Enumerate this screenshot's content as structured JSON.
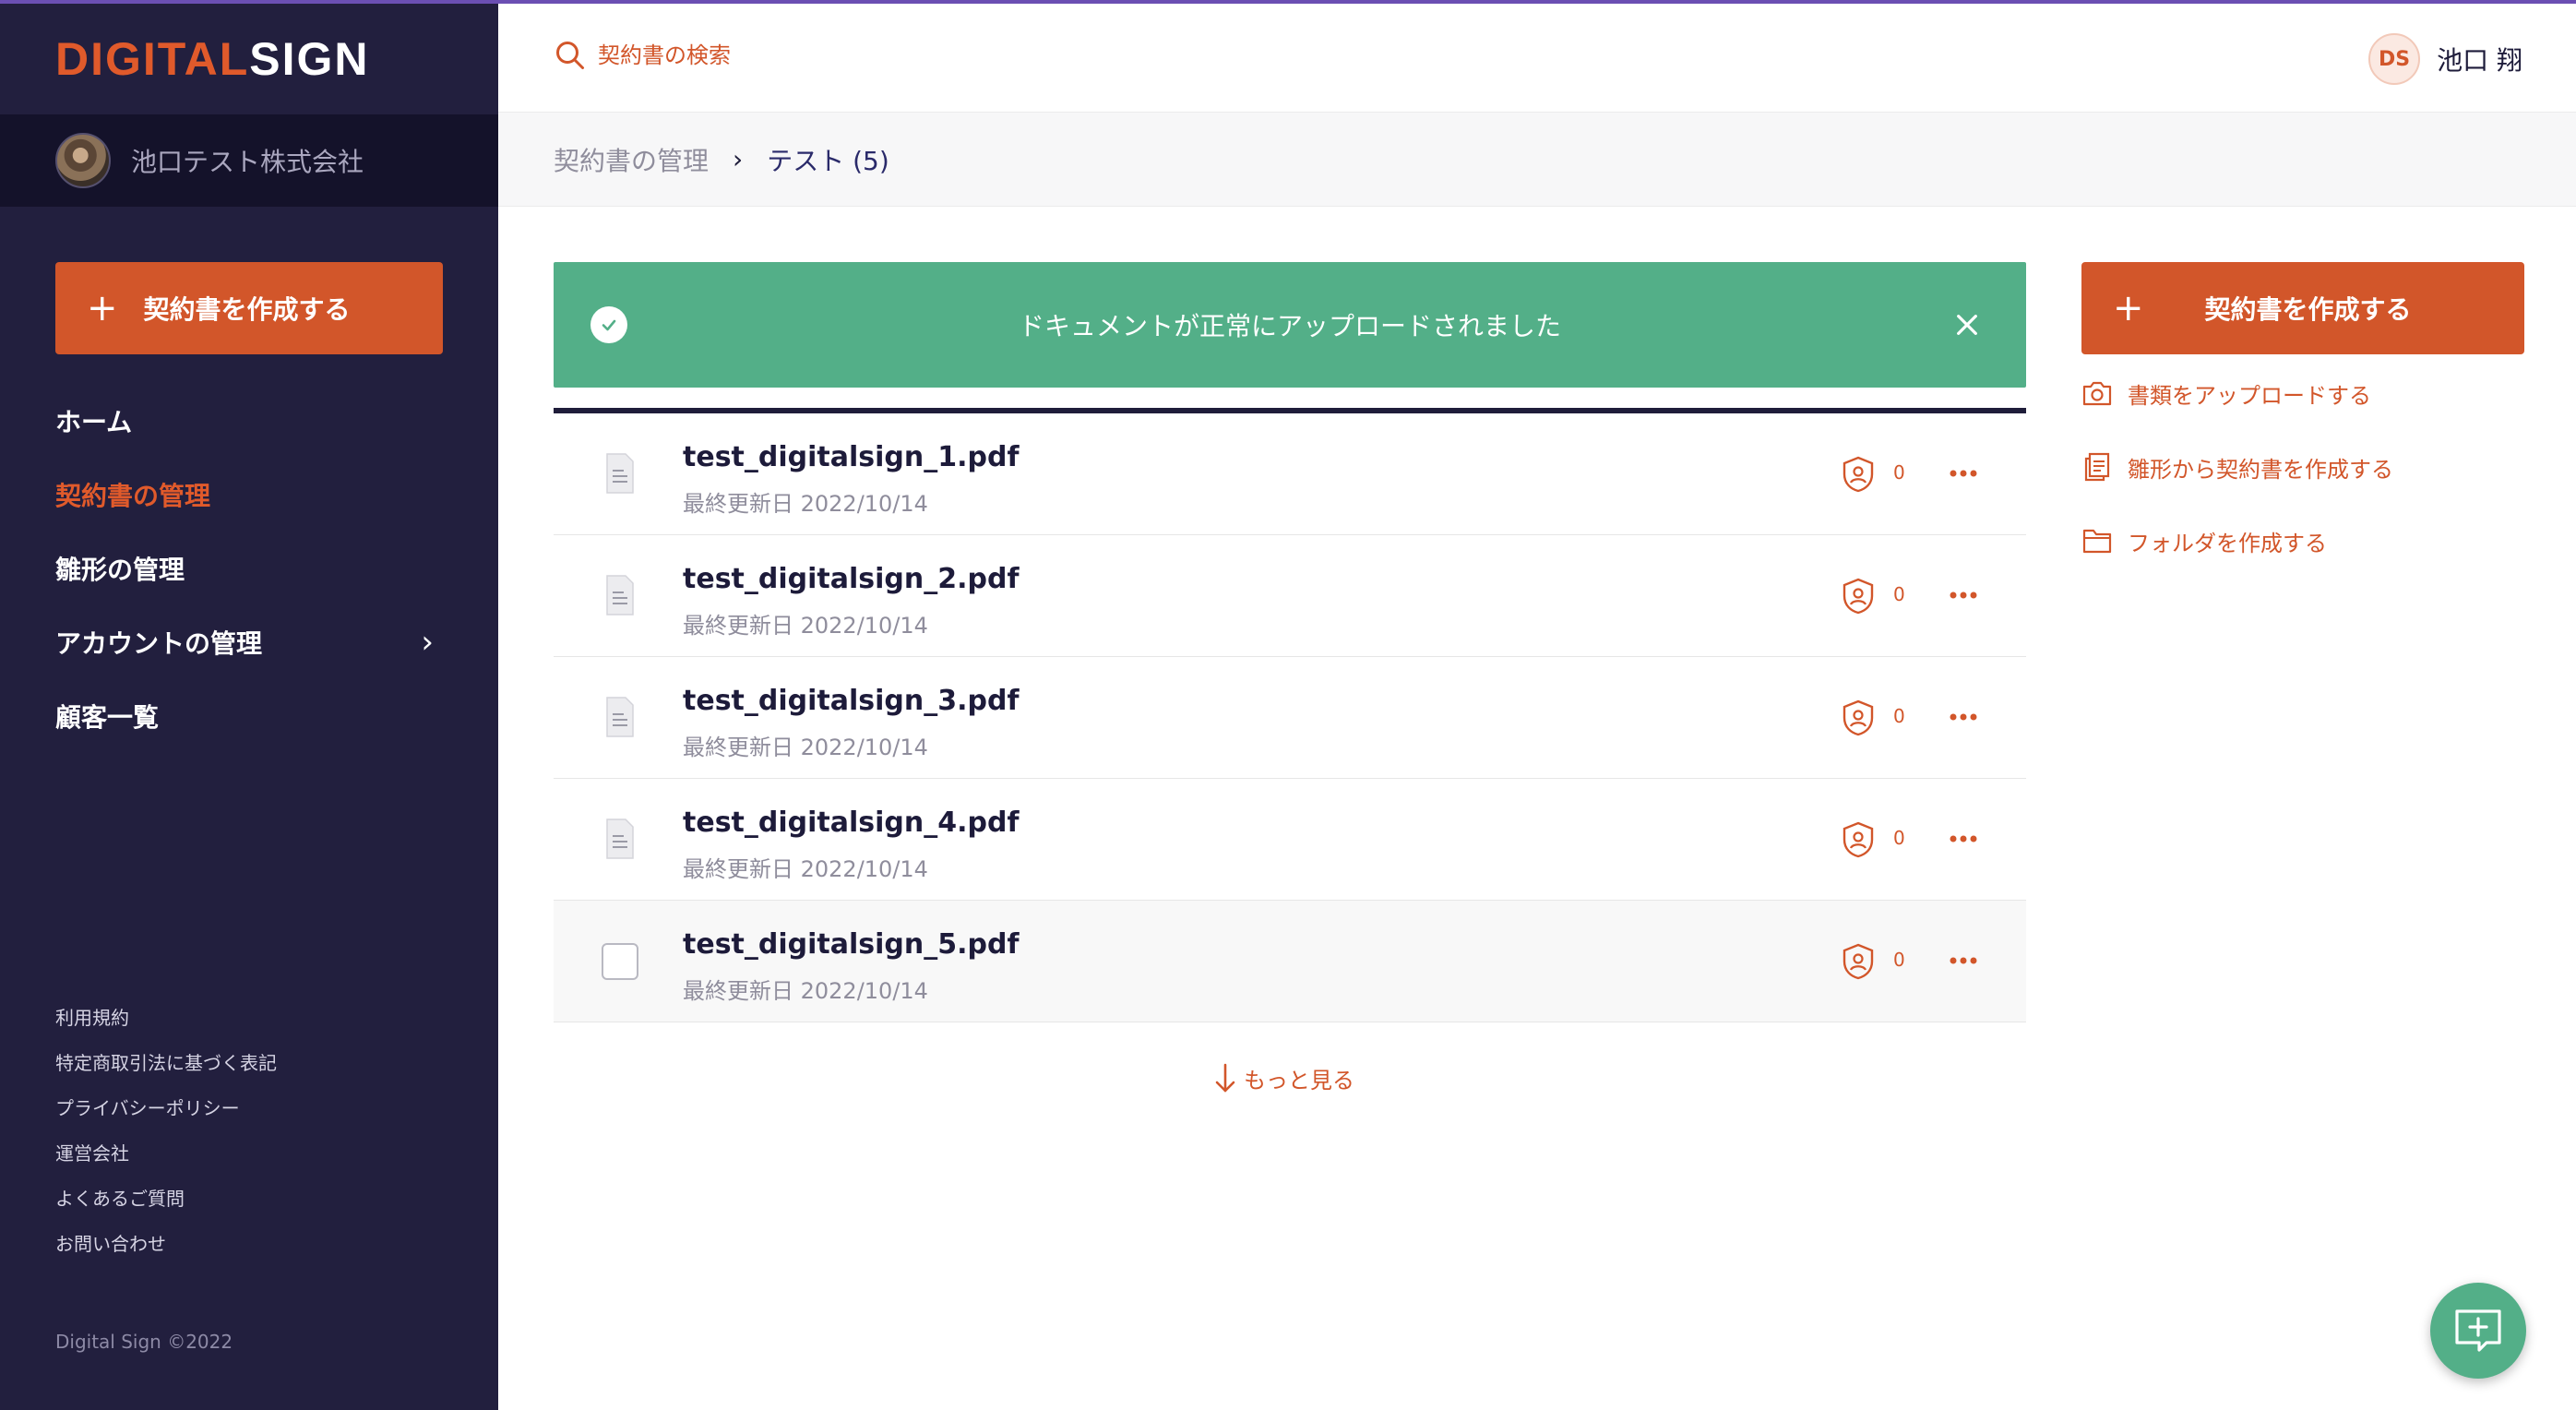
{
  "brand": {
    "logo_part1": "DIGITAL",
    "logo_part2": "SIGN",
    "accent": "#d2562a",
    "sidebar_bg": "#221f3e",
    "success": "#53af88"
  },
  "sidebar": {
    "org_name": "池口テスト株式会社",
    "create_label": "契約書を作成する",
    "nav": [
      {
        "label": "ホーム"
      },
      {
        "label": "契約書の管理"
      },
      {
        "label": "雛形の管理"
      },
      {
        "label": "アカウントの管理"
      },
      {
        "label": "顧客一覧"
      }
    ],
    "footer_links": [
      "利用規約",
      "特定商取引法に基づく表記",
      "プライバシーポリシー",
      "運営会社",
      "よくあるご質問",
      "お問い合わせ"
    ],
    "copyright": "Digital Sign ©2022"
  },
  "header": {
    "search_placeholder": "契約書の検索",
    "user_initials": "DS",
    "user_name": "池口 翔"
  },
  "breadcrumb": {
    "parent": "契約書の管理",
    "current": "テスト (5)"
  },
  "alert": {
    "message": "ドキュメントが正常にアップロードされました"
  },
  "documents": [
    {
      "name": "test_digitalsign_1.pdf",
      "updated": "最終更新日 2022/10/14",
      "signers": "0"
    },
    {
      "name": "test_digitalsign_2.pdf",
      "updated": "最終更新日 2022/10/14",
      "signers": "0"
    },
    {
      "name": "test_digitalsign_3.pdf",
      "updated": "最終更新日 2022/10/14",
      "signers": "0"
    },
    {
      "name": "test_digitalsign_4.pdf",
      "updated": "最終更新日 2022/10/14",
      "signers": "0"
    },
    {
      "name": "test_digitalsign_5.pdf",
      "updated": "最終更新日 2022/10/14",
      "signers": "0"
    }
  ],
  "more_label": "もっと見る",
  "right_panel": {
    "create_label": "契約書を作成する",
    "actions": [
      {
        "label": "書類をアップロードする",
        "icon": "camera-icon"
      },
      {
        "label": "雛形から契約書を作成する",
        "icon": "documents-icon"
      },
      {
        "label": "フォルダを作成する",
        "icon": "folder-icon"
      }
    ]
  }
}
